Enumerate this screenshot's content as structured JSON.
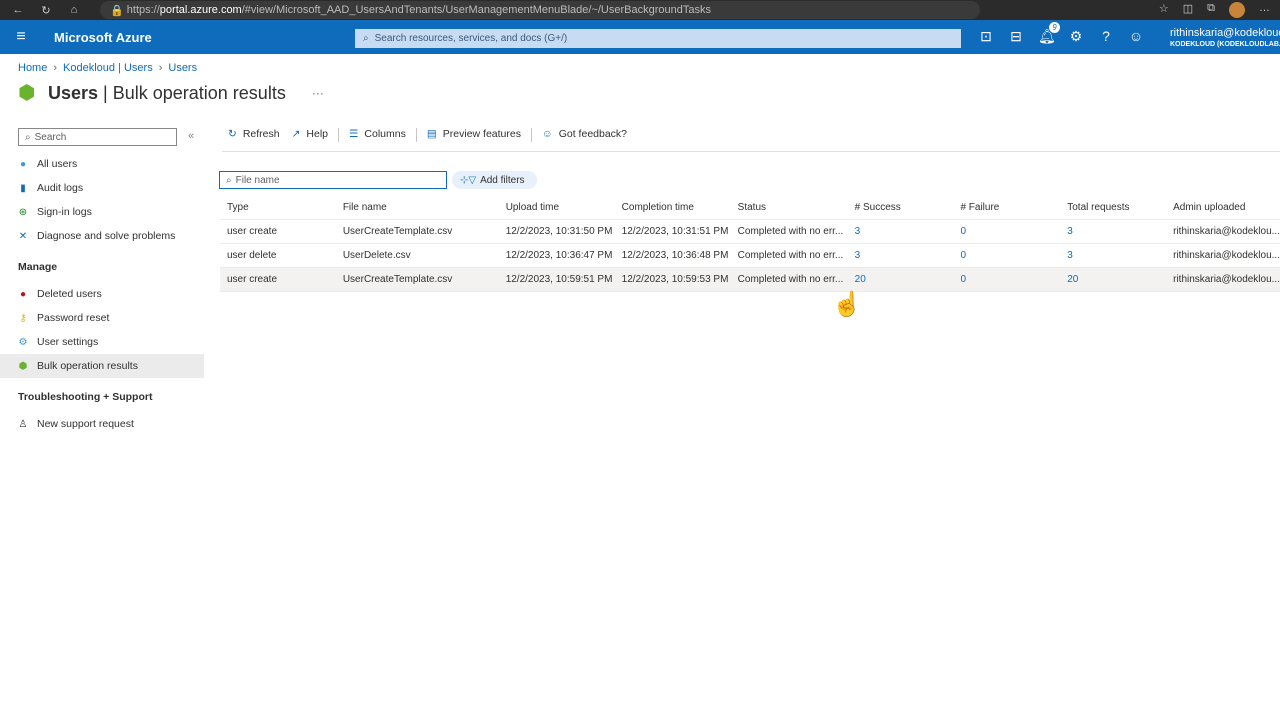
{
  "browser": {
    "url_prefix": "https://",
    "url_host": "portal.azure.com",
    "url_path": "/#view/Microsoft_AAD_UsersAndTenants/UserManagementMenuBlade/~/UserBackgroundTasks"
  },
  "topbar": {
    "brand": "Microsoft Azure",
    "search_placeholder": "Search resources, services, and docs (G+/)",
    "notifications": "9",
    "account_name": "rithinskaria@kodekloud",
    "account_tenant": "KODEKLOUD (KODEKLOUDLAB."
  },
  "breadcrumb": [
    "Home",
    "Kodekloud | Users",
    "Users"
  ],
  "page": {
    "title_bold": "Users",
    "title_rest": " | Bulk operation results",
    "more": "···"
  },
  "sidebar": {
    "search_placeholder": "Search",
    "collapse": "«",
    "items": [
      {
        "label": "All users",
        "icon": "user-icon"
      },
      {
        "label": "Audit logs",
        "icon": "log-icon"
      },
      {
        "label": "Sign-in logs",
        "icon": "signin-icon"
      },
      {
        "label": "Diagnose and solve problems",
        "icon": "wrench-icon"
      }
    ],
    "manage_header": "Manage",
    "manage": [
      {
        "label": "Deleted users",
        "icon": "deleted-user-icon"
      },
      {
        "label": "Password reset",
        "icon": "key-icon"
      },
      {
        "label": "User settings",
        "icon": "settings-icon"
      },
      {
        "label": "Bulk operation results",
        "icon": "bulk-icon",
        "active": true
      }
    ],
    "support_header": "Troubleshooting + Support",
    "support": [
      {
        "label": "New support request",
        "icon": "support-icon"
      }
    ]
  },
  "toolbar": {
    "refresh": "Refresh",
    "help": "Help",
    "columns": "Columns",
    "preview": "Preview features",
    "feedback": "Got feedback?"
  },
  "filter": {
    "placeholder": "File name",
    "add_filters": "Add filters"
  },
  "table": {
    "headers": [
      "Type",
      "File name",
      "Upload time",
      "Completion time",
      "Status",
      "# Success",
      "# Failure",
      "Total requests",
      "Admin uploaded"
    ],
    "rows": [
      [
        "user create",
        "UserCreateTemplate.csv",
        "12/2/2023, 10:31:50 PM",
        "12/2/2023, 10:31:51 PM",
        "Completed with no err...",
        "3",
        "0",
        "3",
        "rithinskaria@kodeklou..."
      ],
      [
        "user delete",
        "UserDelete.csv",
        "12/2/2023, 10:36:47 PM",
        "12/2/2023, 10:36:48 PM",
        "Completed with no err...",
        "3",
        "0",
        "3",
        "rithinskaria@kodeklou..."
      ],
      [
        "user create",
        "UserCreateTemplate.csv",
        "12/2/2023, 10:59:51 PM",
        "12/2/2023, 10:59:53 PM",
        "Completed with no err...",
        "20",
        "0",
        "20",
        "rithinskaria@kodeklou..."
      ]
    ]
  }
}
